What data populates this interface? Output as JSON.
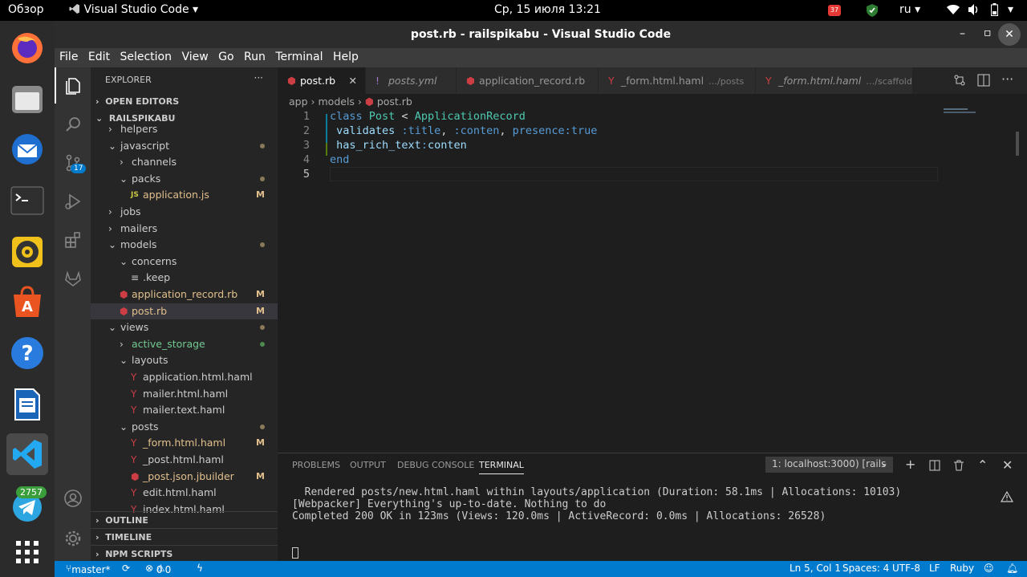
{
  "topbar": {
    "overview": "Обзор",
    "app_name": "Visual Studio Code",
    "datetime": "Ср, 15 июля  13:21",
    "lang": "ru",
    "notif_count": "37"
  },
  "dock": {
    "telegram_badge": "2757"
  },
  "window": {
    "title": "post.rb - railspikabu - Visual Studio Code"
  },
  "menu": [
    "File",
    "Edit",
    "Selection",
    "View",
    "Go",
    "Run",
    "Terminal",
    "Help"
  ],
  "activity": {
    "scm_badge": "17"
  },
  "sidebar": {
    "header": "EXPLORER",
    "open_editors": "OPEN EDITORS",
    "project": "RAILSPIKABU",
    "outline": "OUTLINE",
    "timeline": "TIMELINE",
    "npm": "NPM SCRIPTS",
    "tree": [
      {
        "label": "helpers",
        "indent": 1,
        "kind": "folder-closed",
        "status": ""
      },
      {
        "label": "javascript",
        "indent": 1,
        "kind": "folder-open",
        "status": "dot"
      },
      {
        "label": "channels",
        "indent": 2,
        "kind": "folder-closed",
        "status": ""
      },
      {
        "label": "packs",
        "indent": 2,
        "kind": "folder-open",
        "status": "dot"
      },
      {
        "label": "application.js",
        "indent": 3,
        "kind": "js",
        "status": "M"
      },
      {
        "label": "jobs",
        "indent": 1,
        "kind": "folder-closed",
        "status": ""
      },
      {
        "label": "mailers",
        "indent": 1,
        "kind": "folder-closed",
        "status": ""
      },
      {
        "label": "models",
        "indent": 1,
        "kind": "folder-open",
        "status": "dot"
      },
      {
        "label": "concerns",
        "indent": 2,
        "kind": "folder-open",
        "status": ""
      },
      {
        "label": ".keep",
        "indent": 3,
        "kind": "txt",
        "status": ""
      },
      {
        "label": "application_record.rb",
        "indent": 2,
        "kind": "ruby",
        "status": "M"
      },
      {
        "label": "post.rb",
        "indent": 2,
        "kind": "ruby",
        "status": "M"
      },
      {
        "label": "views",
        "indent": 1,
        "kind": "folder-open",
        "status": "dot"
      },
      {
        "label": "active_storage",
        "indent": 2,
        "kind": "folder-closed-green",
        "status": "dotg"
      },
      {
        "label": "layouts",
        "indent": 2,
        "kind": "folder-open",
        "status": ""
      },
      {
        "label": "application.html.haml",
        "indent": 3,
        "kind": "haml",
        "status": ""
      },
      {
        "label": "mailer.html.haml",
        "indent": 3,
        "kind": "haml",
        "status": ""
      },
      {
        "label": "mailer.text.haml",
        "indent": 3,
        "kind": "haml",
        "status": ""
      },
      {
        "label": "posts",
        "indent": 2,
        "kind": "folder-open",
        "status": "dot"
      },
      {
        "label": "_form.html.haml",
        "indent": 3,
        "kind": "haml",
        "status": "M"
      },
      {
        "label": "_post.html.haml",
        "indent": 3,
        "kind": "haml",
        "status": ""
      },
      {
        "label": "_post.json.jbuilder",
        "indent": 3,
        "kind": "ruby",
        "status": "M"
      },
      {
        "label": "edit.html.haml",
        "indent": 3,
        "kind": "haml",
        "status": ""
      },
      {
        "label": "index.html.haml",
        "indent": 3,
        "kind": "haml",
        "status": ""
      }
    ]
  },
  "tabs": [
    {
      "label": "post.rb",
      "sub": "",
      "icon": "ruby",
      "active": true
    },
    {
      "label": "posts.yml",
      "sub": "",
      "icon": "yml",
      "active": false
    },
    {
      "label": "application_record.rb",
      "sub": "",
      "icon": "ruby",
      "active": false
    },
    {
      "label": "_form.html.haml",
      "sub": "…/posts",
      "icon": "haml",
      "active": false
    },
    {
      "label": "_form.html.haml",
      "sub": "…/scaffold",
      "icon": "haml",
      "active": false
    }
  ],
  "breadcrumb": [
    "app",
    "models",
    "post.rb"
  ],
  "code": [
    {
      "n": "1",
      "html": "<span class=\"kw\">class</span> <span class=\"cls\">Post</span> &lt; <span class=\"cls\">ApplicationRecord</span>"
    },
    {
      "n": "2",
      "html": " <span class=\"fn\">validates</span> <span class=\"sym\">:title</span>, <span class=\"sym\">:conten</span>, <span class=\"sym\">presence:</span><span class=\"kw\">true</span>"
    },
    {
      "n": "3",
      "html": " <span class=\"fn\">has_rich_text</span><span class=\"sym\">:</span><span class=\"fn\">conten</span>"
    },
    {
      "n": "4",
      "html": "<span class=\"kw\">end</span>"
    },
    {
      "n": "5",
      "html": ""
    }
  ],
  "panel": {
    "tabs": [
      "PROBLEMS",
      "OUTPUT",
      "DEBUG CONSOLE",
      "TERMINAL"
    ],
    "terminal_select": "1: localhost:3000) [rails",
    "lines": [
      "  Rendered posts/new.html.haml within layouts/application (Duration: 58.1ms | Allocations: 10103)",
      "[Webpacker] Everything's up-to-date. Nothing to do",
      "Completed 200 OK in 123ms (Views: 120.0ms | ActiveRecord: 0.0ms | Allocations: 26528)"
    ]
  },
  "status": {
    "branch": "master*",
    "errors": "0",
    "warnings": "0",
    "position": "Ln 5, Col 1",
    "spaces": "Spaces: 4",
    "encoding": "UTF-8",
    "eol": "LF",
    "language": "Ruby"
  },
  "colors": {
    "accent": "#007acc",
    "ruby": "#cc3e44",
    "modified": "#e2c08d",
    "untracked": "#73c991"
  }
}
